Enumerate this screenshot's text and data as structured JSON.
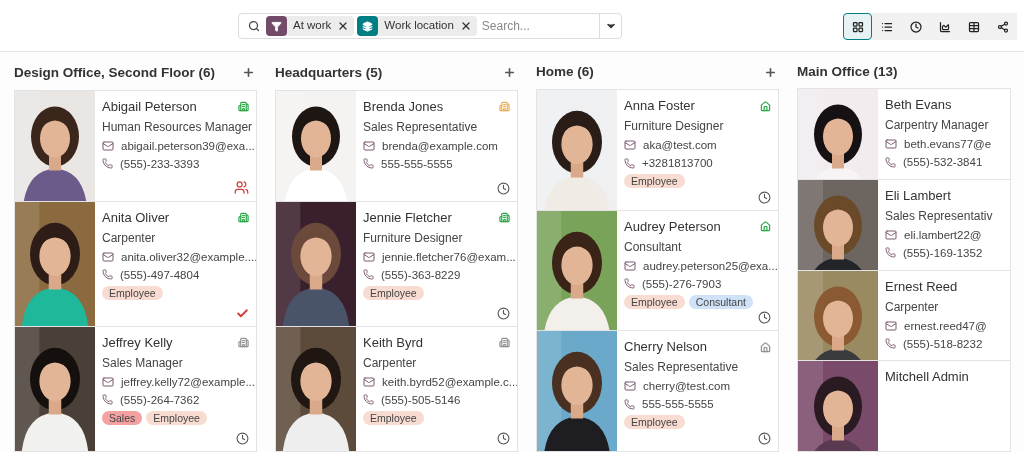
{
  "search": {
    "facets": [
      {
        "kind": "filter",
        "label": "At work"
      },
      {
        "kind": "group",
        "label": "Work location"
      }
    ],
    "placeholder": "Search..."
  },
  "views": [
    {
      "kind": "kanban",
      "selected": true
    },
    {
      "kind": "list",
      "selected": false
    },
    {
      "kind": "activity",
      "selected": false
    },
    {
      "kind": "graph",
      "selected": false
    },
    {
      "kind": "pivot",
      "selected": false
    },
    {
      "kind": "hierarchy",
      "selected": false
    }
  ],
  "columns": [
    {
      "title": "Design Office, Second Floor (6)",
      "cards": [
        {
          "name": "Abigail Peterson",
          "job": "Human Resources Manager",
          "email": "abigail.peterson39@exa...",
          "phone": "(555)-233-3393",
          "presence": {
            "kind": "office",
            "color": "#28a745"
          },
          "activity": {
            "kind": "team"
          }
        },
        {
          "name": "Anita Oliver",
          "job": "Carpenter",
          "email": "anita.oliver32@example....",
          "phone": "(555)-497-4804",
          "presence": {
            "kind": "office",
            "color": "#28a745"
          },
          "tags": [
            {
              "label": "Employee",
              "color": "#f8dcd2"
            }
          ],
          "activity": {
            "kind": "done"
          }
        },
        {
          "name": "Jeffrey Kelly",
          "job": "Sales Manager",
          "email": "jeffrey.kelly72@example....",
          "phone": "(555)-264-7362",
          "presence": {
            "kind": "office",
            "color": "#8f8f8f"
          },
          "tags": [
            {
              "label": "Sales",
              "color": "#f3a1a1"
            },
            {
              "label": "Employee",
              "color": "#f8dcd2"
            }
          ],
          "activity": {
            "kind": "clock"
          }
        }
      ]
    },
    {
      "title": "Headquarters (5)",
      "cards": [
        {
          "name": "Brenda Jones",
          "job": "Sales Representative",
          "email": "brenda@example.com",
          "phone": "555-555-5555",
          "presence": {
            "kind": "office",
            "color": "#f0ad4e"
          },
          "activity": {
            "kind": "clock"
          }
        },
        {
          "name": "Jennie Fletcher",
          "job": "Furniture Designer",
          "email": "jennie.fletcher76@exam...",
          "phone": "(555)-363-8229",
          "presence": {
            "kind": "office",
            "color": "#28a745"
          },
          "tags": [
            {
              "label": "Employee",
              "color": "#f8dcd2"
            }
          ],
          "activity": {
            "kind": "clock"
          }
        },
        {
          "name": "Keith Byrd",
          "job": "Carpenter",
          "email": "keith.byrd52@example.c...",
          "phone": "(555)-505-5146",
          "presence": {
            "kind": "office",
            "color": "#8f8f8f"
          },
          "tags": [
            {
              "label": "Employee",
              "color": "#f8dcd2"
            }
          ],
          "activity": {
            "kind": "clock"
          }
        }
      ]
    },
    {
      "title": "Home (6)",
      "cards": [
        {
          "name": "Anna Foster",
          "job": "Furniture Designer",
          "email": "aka@test.com",
          "phone": "+3281813700",
          "presence": {
            "kind": "home",
            "color": "#28a745"
          },
          "tags": [
            {
              "label": "Employee",
              "color": "#f8dcd2"
            }
          ],
          "activity": {
            "kind": "clock"
          }
        },
        {
          "name": "Audrey Peterson",
          "job": "Consultant",
          "email": "audrey.peterson25@exa...",
          "phone": "(555)-276-7903",
          "presence": {
            "kind": "home",
            "color": "#28a745"
          },
          "tags": [
            {
              "label": "Employee",
              "color": "#f8dcd2"
            },
            {
              "label": "Consultant",
              "color": "#cfe2f7"
            }
          ],
          "activity": {
            "kind": "clock"
          }
        },
        {
          "name": "Cherry Nelson",
          "job": "Sales Representative",
          "email": "cherry@test.com",
          "phone": "555-555-5555",
          "presence": {
            "kind": "home",
            "color": "#8f8f8f"
          },
          "tags": [
            {
              "label": "Employee",
              "color": "#f8dcd2"
            }
          ],
          "activity": {
            "kind": "clock"
          }
        }
      ]
    },
    {
      "title": "Main Office (13)",
      "cards": [
        {
          "name": "Beth Evans",
          "job": "Carpentry Manager",
          "email": "beth.evans77@e",
          "phone": "(555)-532-3841"
        },
        {
          "name": "Eli Lambert",
          "job": "Sales Representativ",
          "email": "eli.lambert22@",
          "phone": "(555)-169-1352"
        },
        {
          "name": "Ernest Reed",
          "job": "Carpenter",
          "email": "ernest.reed47@",
          "phone": "(555)-518-8232"
        },
        {
          "name": "Mitchell Admin"
        }
      ]
    }
  ]
}
